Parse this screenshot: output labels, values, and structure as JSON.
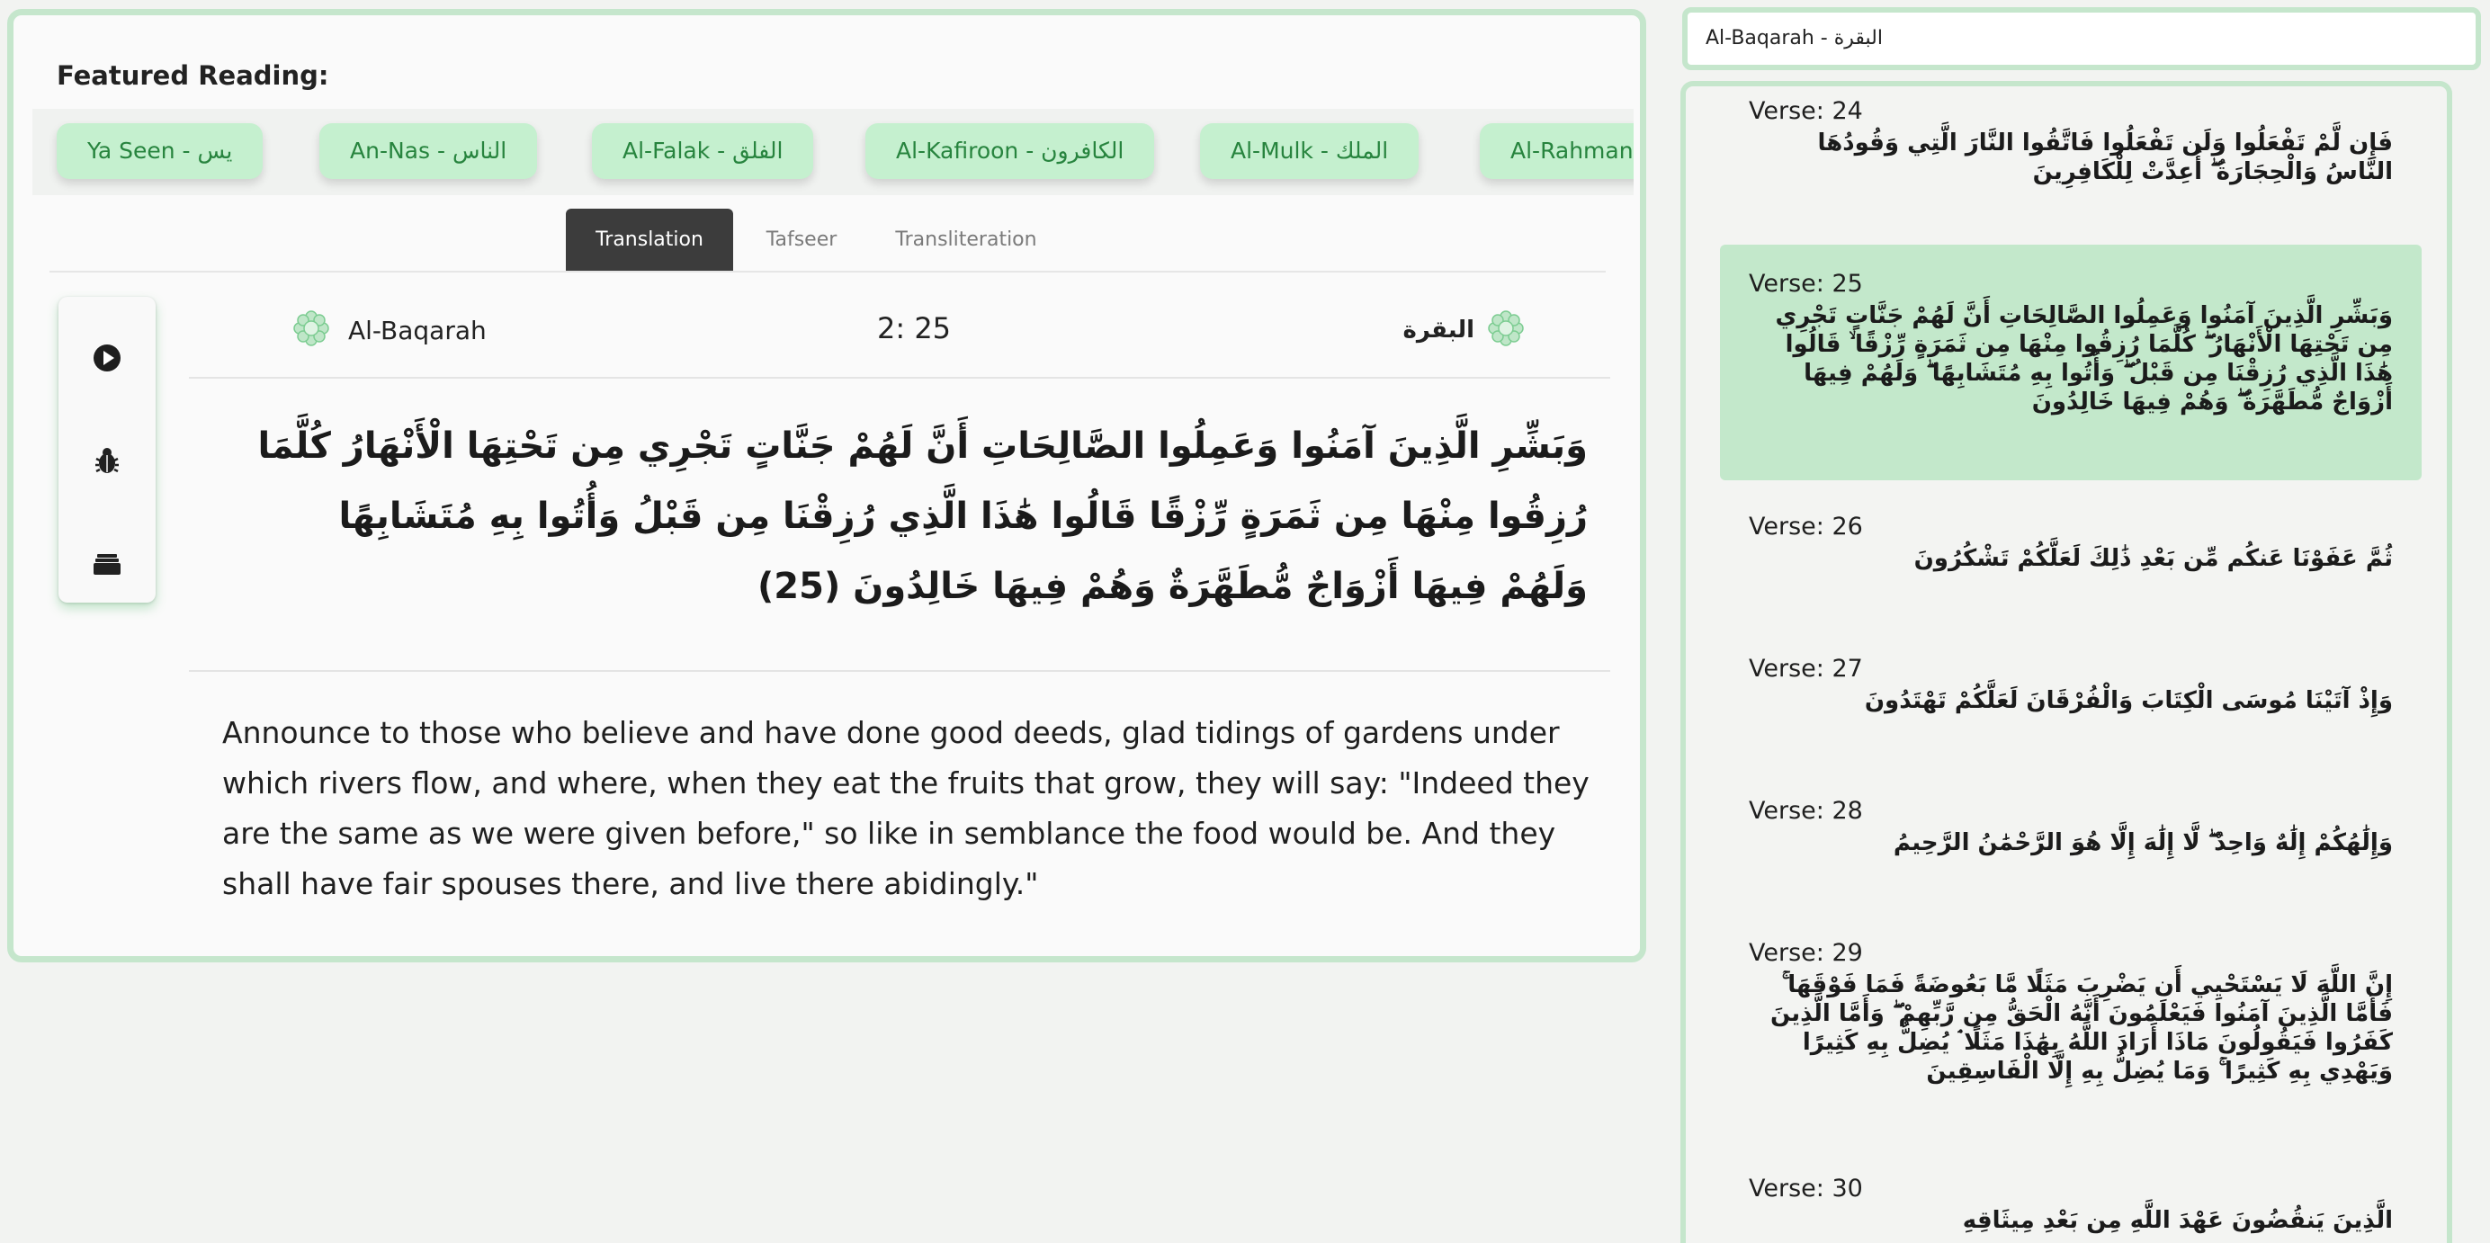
{
  "featured": {
    "title": "Featured Reading:",
    "chips": [
      "Ya Seen - يس",
      "An-Nas - الناس",
      "Al-Falak - الفلق",
      "Al-Kafiroon - الكافرون",
      "Al-Mulk - الملك",
      "Al-Rahman - الرحمن"
    ]
  },
  "tabs": [
    {
      "label": "Translation",
      "active": true
    },
    {
      "label": "Tafseer",
      "active": false
    },
    {
      "label": "Transliteration",
      "active": false
    }
  ],
  "tools": [
    "play-icon",
    "bug-icon",
    "stack-icon"
  ],
  "verse": {
    "surah_en": "Al-Baqarah",
    "ref": "2: 25",
    "surah_ar": "البقرة",
    "arabic": "وَبَشِّرِ الَّذِينَ آمَنُوا وَعَمِلُوا الصَّالِحَاتِ أَنَّ لَهُمْ جَنَّاتٍ تَجْرِي مِن تَحْتِهَا الْأَنْهَارُ كُلَّمَا رُزِقُوا مِنْهَا مِن ثَمَرَةٍ رِّزْقًا قَالُوا هَٰذَا الَّذِي رُزِقْنَا مِن قَبْلُ وَأُتُوا بِهِ مُتَشَابِهًا وَلَهُمْ فِيهَا أَزْوَاجٌ مُّطَهَّرَةٌ وَهُمْ فِيهَا خَالِدُونَ (25)",
    "translation": "Announce to those who believe and have done good deeds, glad tidings of gardens under which rivers flow, and where, when they eat the fruits that grow, they will say: \"Indeed they are the same as we were given before,\" so like in semblance the food would be. And they shall have fair spouses there, and live there abidingly.\""
  },
  "search": {
    "value": "Al-Baqarah - البقرة"
  },
  "verse_list": [
    {
      "label": "Verse: 24",
      "arabic": "فَإِن لَّمْ تَفْعَلُوا وَلَن تَفْعَلُوا فَاتَّقُوا النَّارَ الَّتِي وَقُودُهَا النَّاسُ وَالْحِجَارَةُ ۖ أُعِدَّتْ لِلْكَافِرِينَ"
    },
    {
      "label": "Verse: 25",
      "arabic": "وَبَشِّرِ الَّذِينَ آمَنُوا وَعَمِلُوا الصَّالِحَاتِ أَنَّ لَهُمْ جَنَّاتٍ تَجْرِي مِن تَحْتِهَا الْأَنْهَارُ ۖ كُلَّمَا رُزِقُوا مِنْهَا مِن ثَمَرَةٍ رِّزْقًا ۙ قَالُوا هَٰذَا الَّذِي رُزِقْنَا مِن قَبْلُ ۖ وَأُتُوا بِهِ مُتَشَابِهًا ۖ وَلَهُمْ فِيهَا أَزْوَاجٌ مُّطَهَّرَةٌ ۖ وَهُمْ فِيهَا خَالِدُونَ"
    },
    {
      "label": "Verse: 26",
      "arabic": "ثُمَّ عَفَوْنَا عَنكُم مِّن بَعْدِ ذَٰلِكَ لَعَلَّكُمْ تَشْكُرُونَ"
    },
    {
      "label": "Verse: 27",
      "arabic": "وَإِذْ آتَيْنَا مُوسَى الْكِتَابَ وَالْفُرْقَانَ لَعَلَّكُمْ تَهْتَدُونَ"
    },
    {
      "label": "Verse: 28",
      "arabic": "وَإِلَٰهُكُمْ إِلَٰهٌ وَاحِدٌ ۖ لَّا إِلَٰهَ إِلَّا هُوَ الرَّحْمَٰنُ الرَّحِيمُ"
    },
    {
      "label": "Verse: 29",
      "arabic": "إِنَّ اللَّهَ لَا يَسْتَحْيِي أَن يَضْرِبَ مَثَلًا مَّا بَعُوضَةً فَمَا فَوْقَهَا ۚ فَأَمَّا الَّذِينَ آمَنُوا فَيَعْلَمُونَ أَنَّهُ الْحَقُّ مِن رَّبِّهِمْ ۖ وَأَمَّا الَّذِينَ كَفَرُوا فَيَقُولُونَ مَاذَا أَرَادَ اللَّهُ بِهَٰذَا مَثَلًا ۘ يُضِلُّ بِهِ كَثِيرًا وَيَهْدِي بِهِ كَثِيرًا ۚ وَمَا يُضِلُّ بِهِ إِلَّا الْفَاسِقِينَ"
    },
    {
      "label": "Verse: 30",
      "arabic": "الَّذِينَ يَنقُضُونَ عَهْدَ اللَّهِ مِن بَعْدِ مِيثَاقِهِ"
    }
  ],
  "colors": {
    "accent": "#c5e6cc",
    "chip_bg": "#c5f0cf",
    "chip_text": "#27843e",
    "selected_bg": "#c3e8cb",
    "tab_active": "#3c3c3c"
  }
}
